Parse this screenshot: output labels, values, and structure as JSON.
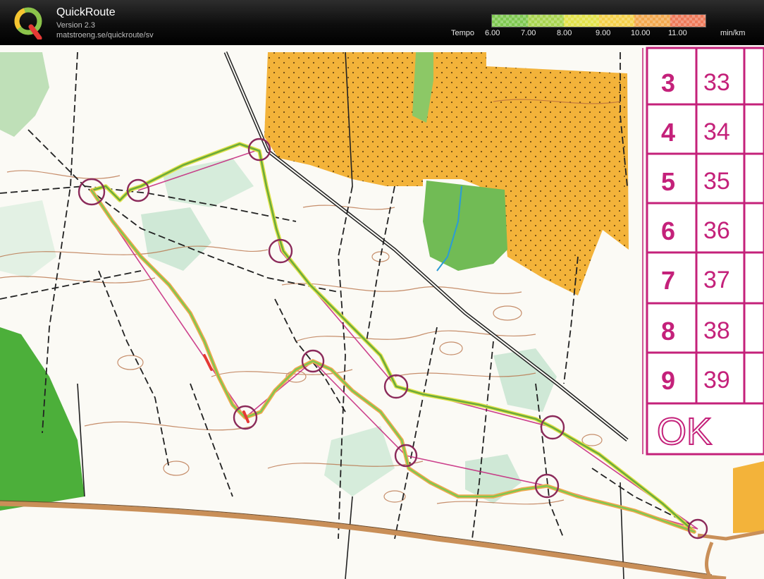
{
  "app": {
    "title": "QuickRoute",
    "version": "Version 2.3",
    "url": "matstroeng.se/quickroute/sv",
    "logo_icon": "quickroute-q-logo-icon"
  },
  "legend": {
    "label": "Tempo",
    "unit": "min/km",
    "ticks": [
      "6.00",
      "7.00",
      "8.00",
      "9.00",
      "10.00",
      "11.00"
    ],
    "colors": [
      "#7ec850",
      "#a8d44f",
      "#e2e24a",
      "#f4d04a",
      "#f2a84e",
      "#ee7a5a"
    ]
  },
  "map": {
    "control_table": {
      "left_numbers": [
        "3",
        "4",
        "5",
        "6",
        "7",
        "8",
        "9"
      ],
      "right_numbers": [
        "33",
        "34",
        "35",
        "36",
        "37",
        "38",
        "39"
      ],
      "finish_text": "OK"
    },
    "colors": {
      "field_orange": "#f3b33a",
      "forest_green": "#4caf3a",
      "course_magenta": "#c4217a",
      "route_green": "#6cab3a",
      "road_brown": "#c98f58"
    }
  }
}
